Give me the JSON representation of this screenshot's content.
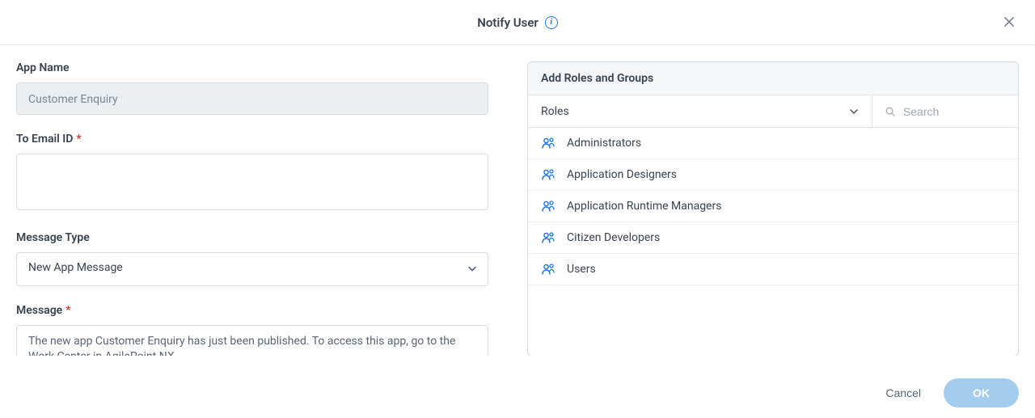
{
  "header": {
    "title": "Notify User",
    "info_label": "i"
  },
  "form": {
    "app_name": {
      "label": "App Name",
      "value": "Customer Enquiry"
    },
    "to_email": {
      "label": "To Email ID",
      "value": ""
    },
    "message_type": {
      "label": "Message Type",
      "value": "New App Message"
    },
    "message": {
      "label": "Message",
      "value": "The new app Customer Enquiry has just been published. To access this app, go to the Work Center in AgilePoint NX"
    }
  },
  "panel": {
    "title": "Add Roles and Groups",
    "filter_selected": "Roles",
    "search_placeholder": "Search",
    "roles": [
      "Administrators",
      "Application Designers",
      "Application Runtime Managers",
      "Citizen Developers",
      "Users"
    ]
  },
  "footer": {
    "cancel": "Cancel",
    "ok": "OK"
  }
}
